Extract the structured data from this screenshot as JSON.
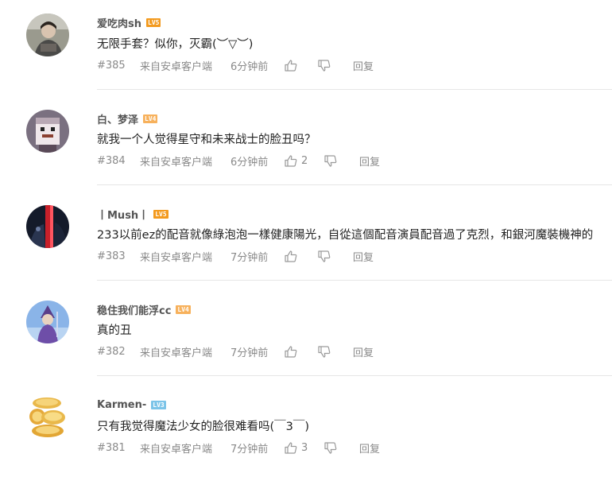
{
  "comments": [
    {
      "username": "爱吃肉sh",
      "level": "LV5",
      "level_color": "#f39a1e",
      "content": "无限手套？似你，灭霸(︶▽︶)",
      "floor": "#385",
      "source": "来自安卓客户端",
      "time": "6分钟前",
      "likes": "",
      "reply": "回复",
      "avatar_icon": "avatar-photo-person"
    },
    {
      "username": "白、梦泽",
      "level": "LV4",
      "level_color": "#f7b15c",
      "content": "就我一个人觉得星守和未来战士的脸丑吗？",
      "floor": "#384",
      "source": "来自安卓客户端",
      "time": "6分钟前",
      "likes": "2",
      "reply": "回复",
      "avatar_icon": "avatar-pixel-character"
    },
    {
      "username": "丨Mush丨",
      "level": "LV5",
      "level_color": "#f39a1e",
      "content": "233以前ez的配音就像綠泡泡一樣健康陽光，自從這個配音演員配音過了克烈，和銀河魔裝機神的",
      "floor": "#383",
      "source": "来自安卓客户端",
      "time": "7分钟前",
      "likes": "",
      "reply": "回复",
      "avatar_icon": "avatar-dark-warrior"
    },
    {
      "username": "稳住我们能浮cc",
      "level": "LV4",
      "level_color": "#f7b15c",
      "content": "真的丑",
      "floor": "#382",
      "source": "来自安卓客户端",
      "time": "7分钟前",
      "likes": "",
      "reply": "回复",
      "avatar_icon": "avatar-purple-character"
    },
    {
      "username": "Karmen-",
      "level": "LV3",
      "level_color": "#7cc4e8",
      "content": "只有我觉得魔法少女的脸很难看吗(￣3￣)",
      "floor": "#381",
      "source": "来自安卓客户端",
      "time": "7分钟前",
      "likes": "3",
      "reply": "回复",
      "avatar_icon": "avatar-gold-coins"
    }
  ],
  "colors": {
    "meta_text": "#8a8a8a",
    "divider": "#e6e6e6",
    "username": "#555555"
  }
}
